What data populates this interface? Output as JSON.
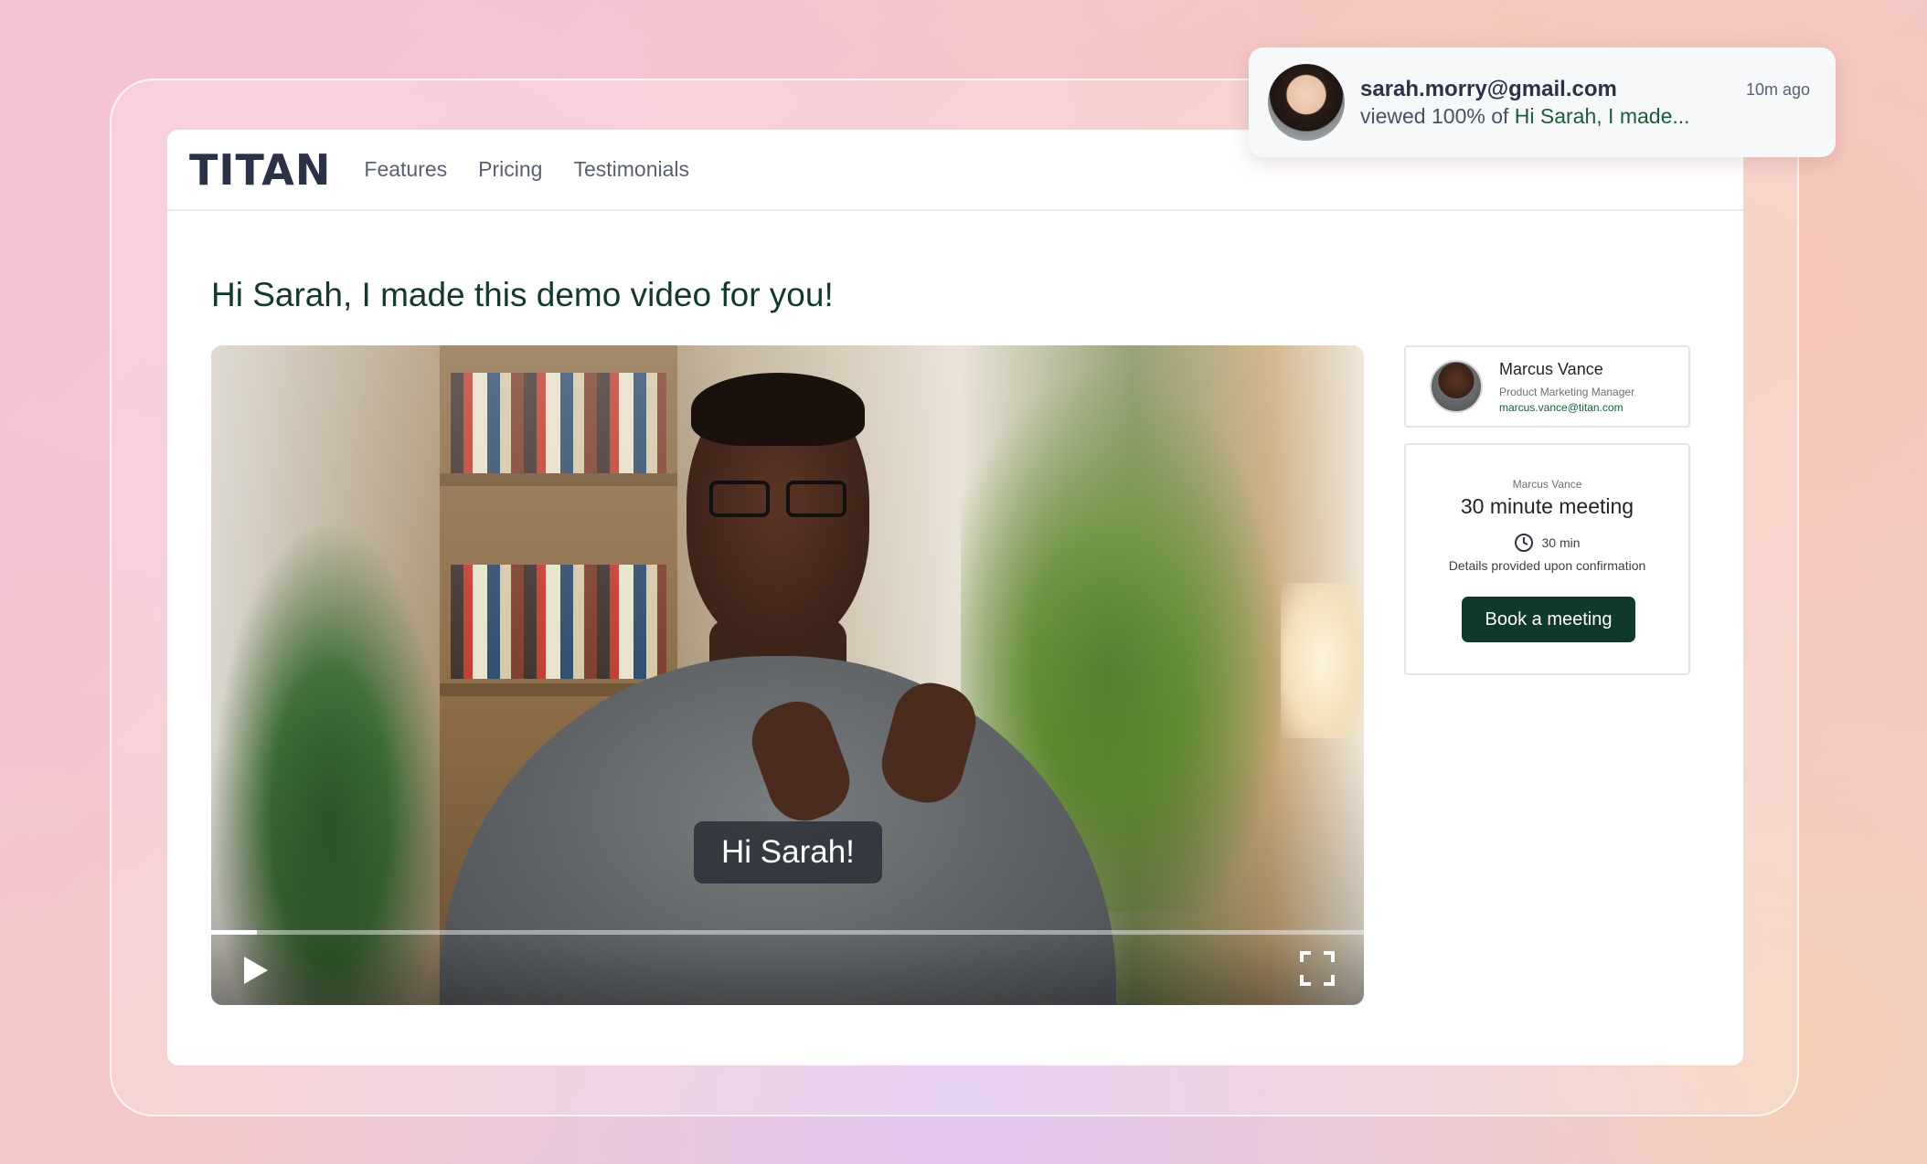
{
  "nav": {
    "logo": "TITAN",
    "links": [
      "Features",
      "Pricing",
      "Testimonials"
    ]
  },
  "page": {
    "headline": "Hi Sarah, I made this demo video for you!"
  },
  "video": {
    "caption": "Hi Sarah!",
    "progress_percent": 4
  },
  "profile": {
    "name": "Marcus Vance",
    "role": "Product Marketing Manager",
    "email": "marcus.vance@titan.com"
  },
  "meeting": {
    "host": "Marcus Vance",
    "title": "30 minute meeting",
    "duration": "30 min",
    "details": "Details provided upon confirmation",
    "cta": "Book a meeting"
  },
  "notification": {
    "email": "sarah.morry@gmail.com",
    "time": "10m ago",
    "action": "viewed 100% of",
    "item": "Hi Sarah, I made..."
  },
  "colors": {
    "brand_dark_green": "#10392a",
    "headline_green": "#14392a",
    "link_green": "#1b5a3a"
  },
  "icons": {
    "play": "play-icon",
    "fullscreen": "fullscreen-icon",
    "clock": "clock-icon"
  }
}
